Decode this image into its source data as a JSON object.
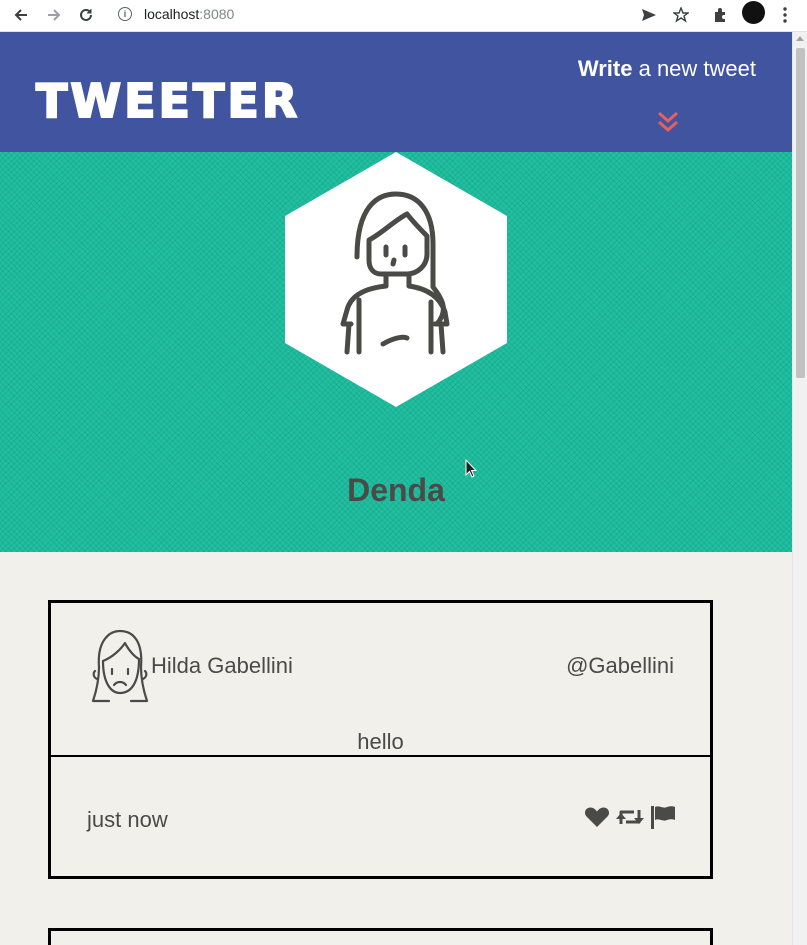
{
  "browser": {
    "url_host": "localhost",
    "url_port": ":8080"
  },
  "header": {
    "logo": "TWEETER",
    "compose_bold": "Write",
    "compose_rest": " a new tweet"
  },
  "profile": {
    "name": "Denda"
  },
  "tweets": [
    {
      "name": "Hilda Gabellini",
      "handle": "@Gabellini",
      "content": "hello",
      "time": "just now"
    }
  ],
  "colors": {
    "nav": "#4154a0",
    "banner": "#1fbfa0",
    "page_bg": "#f2f0ea",
    "chevron": "#e8605c"
  }
}
